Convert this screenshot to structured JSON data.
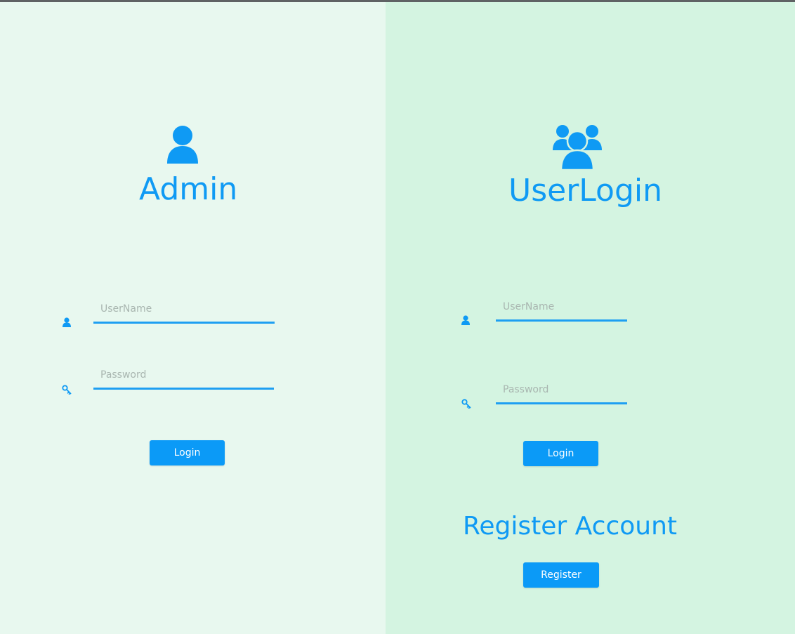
{
  "colors": {
    "accent": "#0f9af4",
    "admin_bg": "#e8f8ef",
    "user_bg": "#d4f4e1",
    "button_bg": "#0b9af7"
  },
  "admin": {
    "title": "Admin",
    "header_icon": "user-icon",
    "username": {
      "placeholder": "UserName",
      "value": "",
      "icon": "user-small-icon"
    },
    "password": {
      "placeholder": "Password",
      "value": "",
      "icon": "key-icon"
    },
    "login_label": "Login"
  },
  "user": {
    "title": "UserLogin",
    "header_icon": "users-group-icon",
    "username": {
      "placeholder": "UserName",
      "value": "",
      "icon": "user-small-icon"
    },
    "password": {
      "placeholder": "Password",
      "value": "",
      "icon": "key-icon"
    },
    "login_label": "Login",
    "register_heading": "Register Account",
    "register_label": "Register"
  }
}
